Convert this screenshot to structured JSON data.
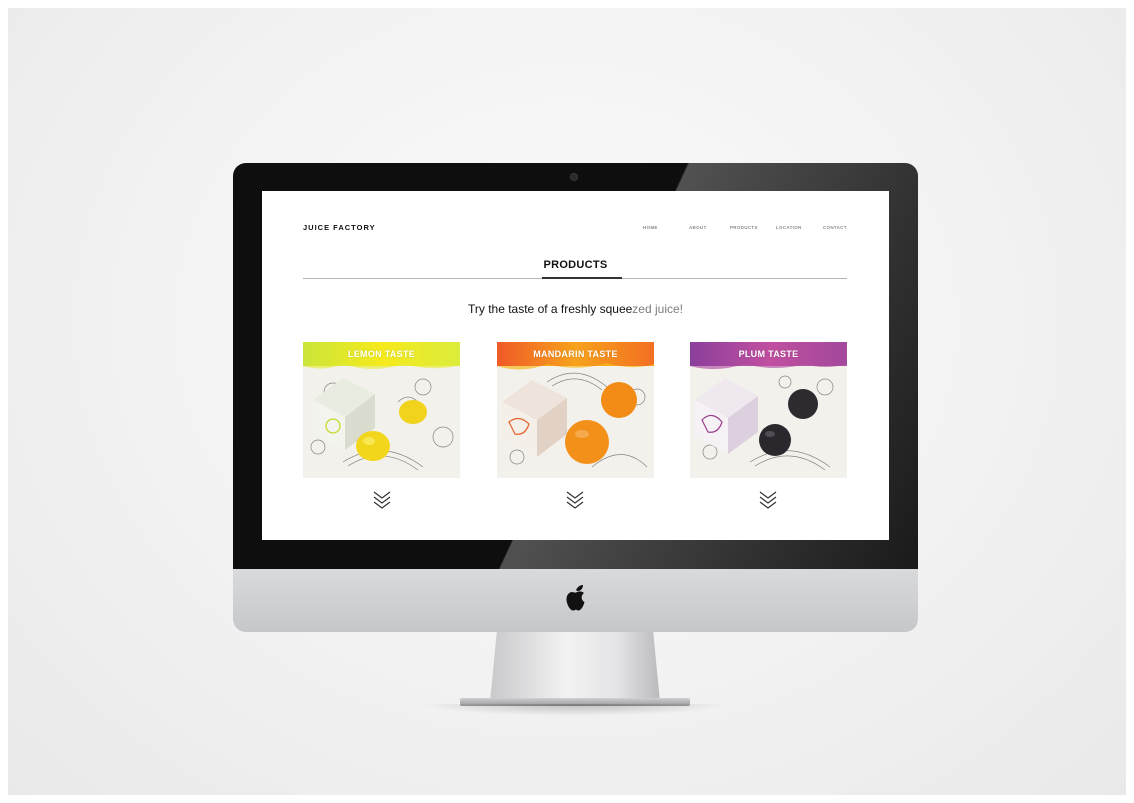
{
  "site": {
    "brand": "JUICE FACTORY",
    "nav": [
      "HOME",
      "ABOUT",
      "PRODUCTS",
      "LOCATION",
      "CONTACT"
    ],
    "page_title": "PRODUCTS",
    "tagline_main": "Try the taste of a freshly squee",
    "tagline_faded": "zed juice!"
  },
  "products": [
    {
      "label": "LEMON TASTE",
      "color": "#f2e619"
    },
    {
      "label": "MANDARIN TASTE",
      "color": "#f47a1f"
    },
    {
      "label": "PLUM TASTE",
      "color": "#a2409c"
    }
  ],
  "icons": {
    "logo": "apple-logo-icon",
    "expand": "triple-chevron-down-icon"
  },
  "colors": {
    "bezel": "#0e0e0e",
    "chin": "#d0d1d3",
    "screen_bg": "#ffffff",
    "nav_text": "#8a8a8a"
  }
}
